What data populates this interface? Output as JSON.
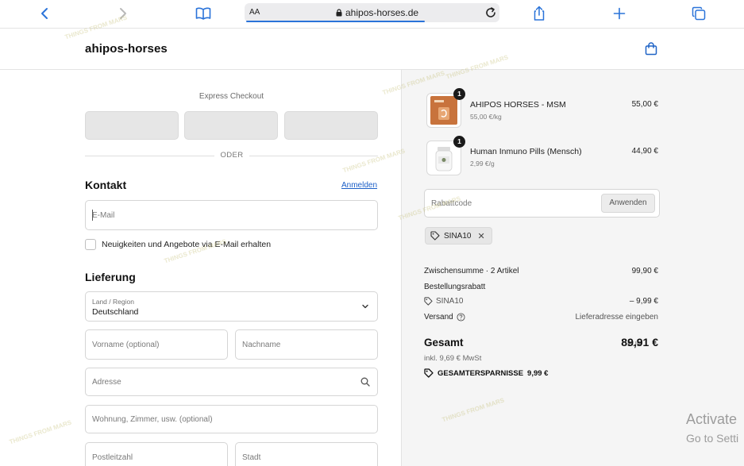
{
  "browser": {
    "text_size_label": "AA",
    "url": "ahipos-horses.de",
    "load_progress": 0.7
  },
  "shop": {
    "name": "ahipos-horses"
  },
  "express": {
    "label": "Express Checkout",
    "divider": "ODER"
  },
  "contact": {
    "title": "Kontakt",
    "login_link": "Anmelden",
    "email_placeholder": "E-Mail",
    "newsletter_label": "Neuigkeiten und Angebote via E-Mail erhalten",
    "newsletter_checked": false
  },
  "delivery": {
    "title": "Lieferung",
    "country_label": "Land / Region",
    "country_value": "Deutschland",
    "first_name_placeholder": "Vorname (optional)",
    "last_name_placeholder": "Nachname",
    "address_placeholder": "Adresse",
    "apartment_placeholder": "Wohnung, Zimmer, usw. (optional)",
    "zip_placeholder": "Postleitzahl",
    "city_placeholder": "Stadt"
  },
  "cart": {
    "items": [
      {
        "name": "AHIPOS HORSES - MSM",
        "unit_price": "55,00 €/kg",
        "price": "55,00 €",
        "quantity": "1",
        "thumb_color": "#c8733c"
      },
      {
        "name": "Human Inmuno Pills (Mensch)",
        "unit_price": "2,99 €/g",
        "price": "44,90 €",
        "quantity": "1",
        "thumb_color": "#eaeaea"
      }
    ],
    "discount_placeholder": "Rabattcode",
    "apply_label": "Anwenden",
    "applied_code": "SINA10",
    "subtotal_label": "Zwischensumme · 2 Artikel",
    "subtotal_value": "99,90 €",
    "order_discount_label": "Bestellungsrabatt",
    "discount_code_line": "SINA10",
    "discount_value": "– 9,99 €",
    "shipping_label": "Versand",
    "shipping_value": "Lieferadresse eingeben",
    "total_label": "Gesamt",
    "currency": "EUR",
    "total_value": "89,91 €",
    "tax_note": "inkl. 9,69 € MwSt",
    "savings_label": "GESAMTERSPARNISSE",
    "savings_value": "9,99 €"
  },
  "os_overlay": {
    "line1": "Activate",
    "line2": "Go to Setti"
  },
  "watermark": "THINGS FROM MARS",
  "colors": {
    "link": "#1c5fc7",
    "summary_bg": "#f5f5f5",
    "progress": "#2a73d9"
  }
}
